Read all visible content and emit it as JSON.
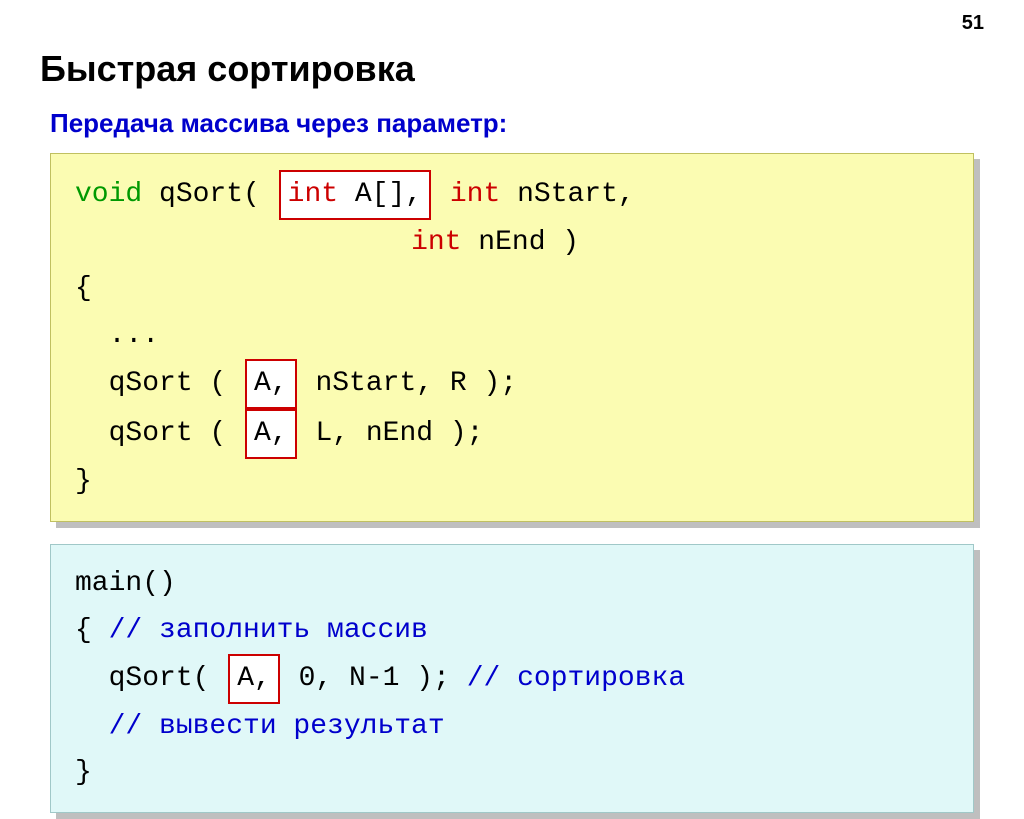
{
  "page_number": "51",
  "title": "Быстрая сортировка",
  "subtitle": "Передача массива через параметр:",
  "block1": {
    "l1_void": "void",
    "l1_qsort": " qSort( ",
    "l1_box_int": "int",
    "l1_box_arr": " A[],",
    "l1_int2": " int",
    "l1_nstart": " nStart,",
    "l2_pad": "                    ",
    "l2_int": "int",
    "l2_nend": " nEnd )",
    "l3": "{",
    "l4": "  ...",
    "l5_a": "  qSort ( ",
    "l5_box": "A,",
    "l5_b": " nStart, R );",
    "l6_a": "  qSort ( ",
    "l6_box": "A,",
    "l6_b": " L, nEnd );",
    "l7": "}"
  },
  "block2": {
    "l1": "main()",
    "l2_a": "{ ",
    "l2_b": "// заполнить массив",
    "l3_a": "  qSort( ",
    "l3_box": "A,",
    "l3_b": " 0, N-1 ); ",
    "l3_c": "// сортировка",
    "l4": "  // вывести результат",
    "l5": "}"
  }
}
